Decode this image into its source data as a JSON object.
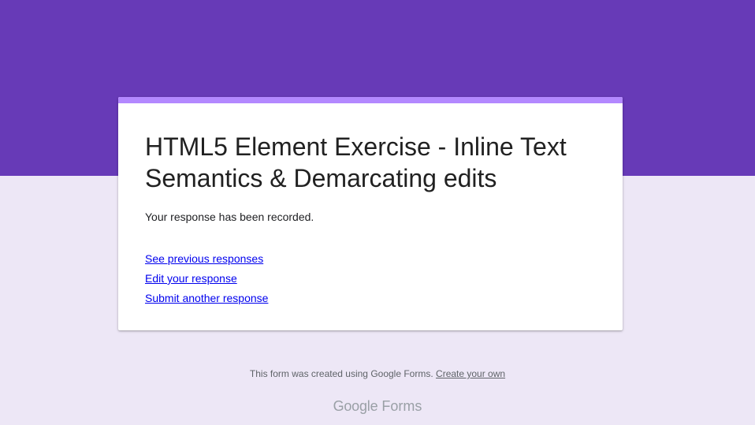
{
  "colors": {
    "header_bg": "#673ab7",
    "page_bg": "#ede7f6",
    "card_accent": "#b388ff",
    "link": "#0000ee"
  },
  "form": {
    "title": "HTML5 Element Exercise - Inline Text Semantics & Demarcating edits",
    "confirmation": "Your response has been recorded.",
    "links": {
      "see_previous": "See previous responses",
      "edit": "Edit your response",
      "submit_another": "Submit another response"
    }
  },
  "footer": {
    "note": "This form was created using Google Forms.",
    "create_link": "Create your own",
    "brand_google": "Google",
    "brand_forms": "Forms"
  }
}
